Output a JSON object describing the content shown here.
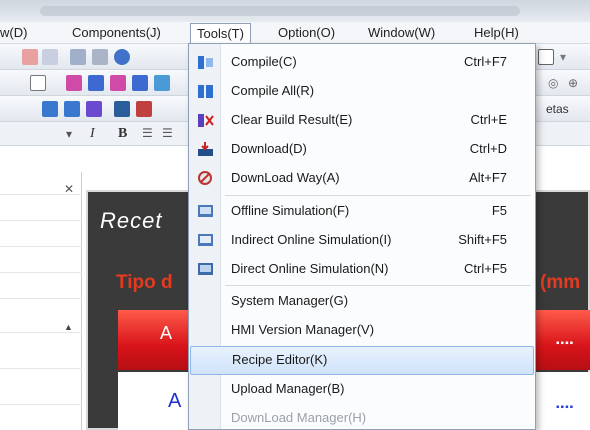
{
  "menubar": {
    "items": [
      {
        "label": "w(D)"
      },
      {
        "label": "Components(J)"
      },
      {
        "label": "Tools(T)"
      },
      {
        "label": "Option(O)"
      },
      {
        "label": "Window(W)"
      },
      {
        "label": "Help(H)"
      }
    ]
  },
  "tools_menu": {
    "items": [
      {
        "label": "Compile(C)",
        "shortcut": "Ctrl+F7",
        "icon": "compile-icon"
      },
      {
        "label": "Compile All(R)",
        "shortcut": "",
        "icon": "compile-all-icon"
      },
      {
        "label": "Clear Build Result(E)",
        "shortcut": "Ctrl+E",
        "icon": "clear-build-icon"
      },
      {
        "label": "Download(D)",
        "shortcut": "Ctrl+D",
        "icon": "download-icon"
      },
      {
        "label": "DownLoad Way(A)",
        "shortcut": "Alt+F7",
        "icon": "download-way-icon"
      },
      {
        "label": "Offline Simulation(F)",
        "shortcut": "F5",
        "icon": "offline-simulation-icon"
      },
      {
        "label": "Indirect Online Simulation(I)",
        "shortcut": "Shift+F5",
        "icon": "indirect-simulation-icon"
      },
      {
        "label": "Direct Online Simulation(N)",
        "shortcut": "Ctrl+F5",
        "icon": "direct-simulation-icon"
      },
      {
        "label": "System Manager(G)",
        "shortcut": ""
      },
      {
        "label": "HMI Version Manager(V)",
        "shortcut": ""
      },
      {
        "label": "Recipe Editor(K)",
        "shortcut": ""
      },
      {
        "label": "Upload Manager(B)",
        "shortcut": ""
      },
      {
        "label": "DownLoad Manager(H)",
        "shortcut": ""
      }
    ],
    "highlighted": "Recipe Editor(K)"
  },
  "toolbar": {
    "format_row": [
      "I",
      "B"
    ],
    "fragments": [
      "etas",
      "(mm"
    ]
  },
  "canvas": {
    "title": "Recet",
    "subtitle": "Tipo d",
    "units": "(mm",
    "red_row_text": "A",
    "blue_row_text": "A",
    "dots": "▪▪▪▪"
  },
  "colors": {
    "menu_highlight": "#cfe3fa",
    "accent_red": "#e53a1f",
    "bar_red": "#d8141a",
    "blue_text": "#1f2fd0",
    "canvas_bg": "#3a3a3a"
  }
}
